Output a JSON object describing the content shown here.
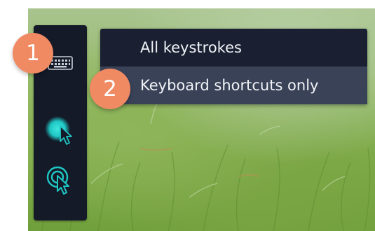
{
  "toolbar": {
    "tools": [
      {
        "icon": "keyboard-icon"
      },
      {
        "icon": "cursor-highlight-icon"
      },
      {
        "icon": "click-cursor-icon"
      }
    ]
  },
  "dropdown": {
    "items": [
      {
        "label": "All keystrokes",
        "selected": false
      },
      {
        "label": "Keyboard shortcuts only",
        "selected": true
      }
    ]
  },
  "callouts": {
    "step1": "1",
    "step2": "2"
  },
  "colors": {
    "toolbar_bg": "#151a29",
    "menu_bg": "#1a2032",
    "menu_highlight": "#3a4258",
    "accent_teal": "#1fc7c4",
    "callout_orange": "#f08a63"
  }
}
